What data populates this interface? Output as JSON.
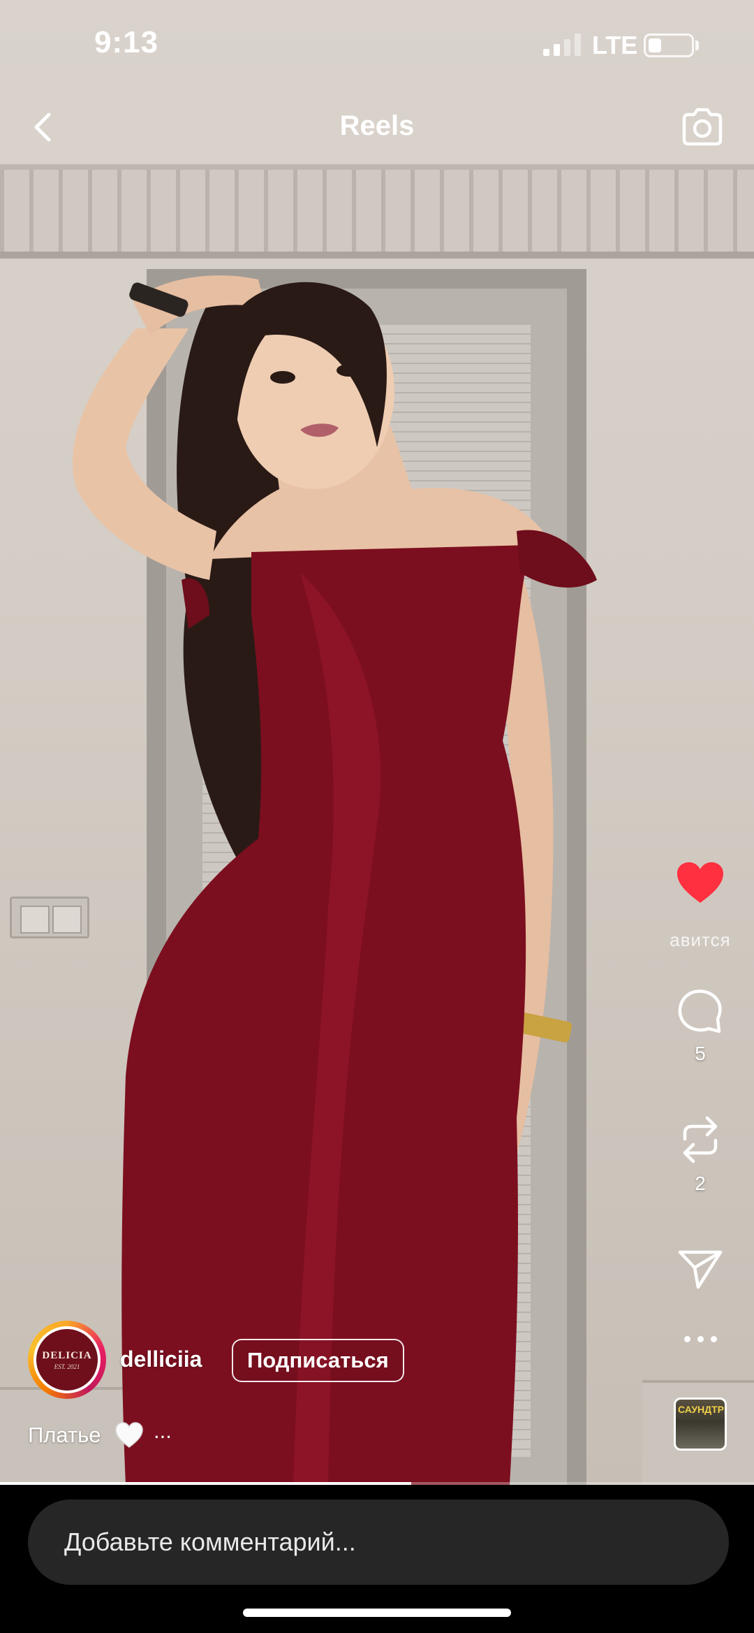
{
  "status_bar": {
    "time": "9:13",
    "network": "LTE",
    "battery_level": 0.3,
    "signal_bars_active": 2
  },
  "header": {
    "title": "Reels",
    "back_icon": "chevron-left-icon",
    "camera_icon": "camera-icon"
  },
  "actions": {
    "like": {
      "icon": "heart-icon",
      "liked": true,
      "color": "#ff3040",
      "label": "авится"
    },
    "comment": {
      "icon": "comment-icon",
      "count": "5"
    },
    "repost": {
      "icon": "repost-icon",
      "count": "2"
    },
    "share": {
      "icon": "send-icon"
    },
    "more": {
      "icon": "more-horizontal-icon"
    }
  },
  "author": {
    "username": "delliciia",
    "avatar_text": "DELICIA",
    "avatar_subtext": "EST. 2021",
    "follow_label": "Подписаться"
  },
  "caption": {
    "text": "Платье",
    "emoji": "white-heart-icon",
    "more": "..."
  },
  "audio": {
    "thumb_text": "САУНДТРЕК"
  },
  "playback": {
    "progress": 0.545
  },
  "comment_bar": {
    "placeholder": "Добавьте комментарий..."
  }
}
